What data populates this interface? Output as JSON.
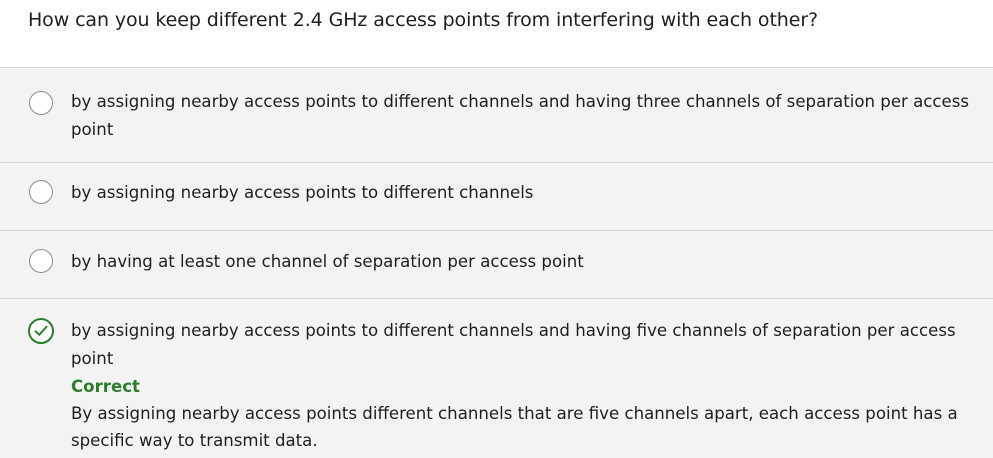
{
  "question": {
    "text": "How can you keep different 2.4 GHz access points from interfering with each other?"
  },
  "options": [
    {
      "text": "by assigning nearby access points to different channels and having three channels of separation per access point",
      "selected": false
    },
    {
      "text": "by assigning nearby access points to different channels",
      "selected": false
    },
    {
      "text": "by having at least one channel of separation per access point",
      "selected": false
    },
    {
      "text": "by assigning nearby access points to different channels and having five channels of separation per access point",
      "selected": true
    }
  ],
  "feedback": {
    "label": "Correct",
    "text": "By assigning nearby access points different channels that are five channels apart, each access point has a specific way to transmit data."
  },
  "colors": {
    "correct": "#2d7d2d",
    "option_background": "#f3f3f3",
    "divider": "#d6d6d6"
  },
  "icons": {
    "selected_indicator": "check-circle-icon",
    "unselected_indicator": "radio-circle-icon"
  }
}
